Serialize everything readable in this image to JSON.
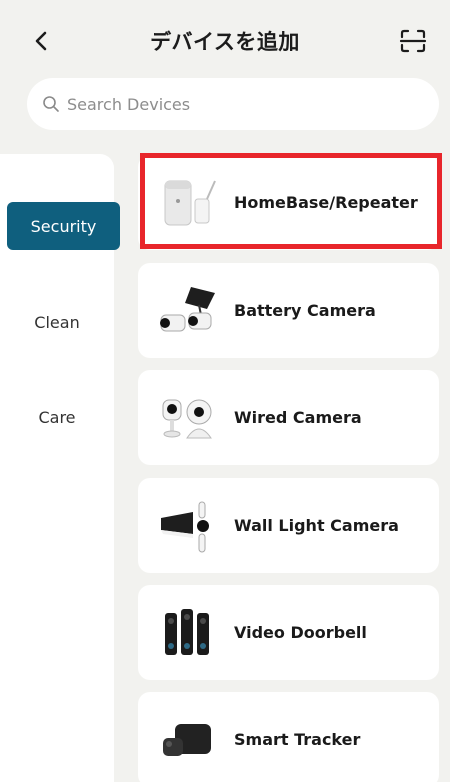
{
  "header": {
    "title": "デバイスを追加",
    "back_icon": "chevron-left-icon",
    "scan_icon": "scan-icon"
  },
  "search": {
    "placeholder": "Search Devices",
    "value": "",
    "icon": "search-icon"
  },
  "sidebar": {
    "items": [
      {
        "label": "Security",
        "active": true
      },
      {
        "label": "Clean",
        "active": false
      },
      {
        "label": "Care",
        "active": false
      }
    ],
    "active_color": "#0f5f7e"
  },
  "devices": [
    {
      "label": "HomeBase/Repeater",
      "icon": "homebase-icon",
      "selected": true
    },
    {
      "label": "Battery Camera",
      "icon": "battery-camera-icon",
      "selected": false
    },
    {
      "label": "Wired Camera",
      "icon": "wired-camera-icon",
      "selected": false
    },
    {
      "label": "Wall Light Camera",
      "icon": "wall-light-camera-icon",
      "selected": false
    },
    {
      "label": "Video Doorbell",
      "icon": "video-doorbell-icon",
      "selected": false
    },
    {
      "label": "Smart Tracker",
      "icon": "smart-tracker-icon",
      "selected": false
    }
  ],
  "colors": {
    "background": "#f2f2ef",
    "highlight": "#e8262b"
  }
}
